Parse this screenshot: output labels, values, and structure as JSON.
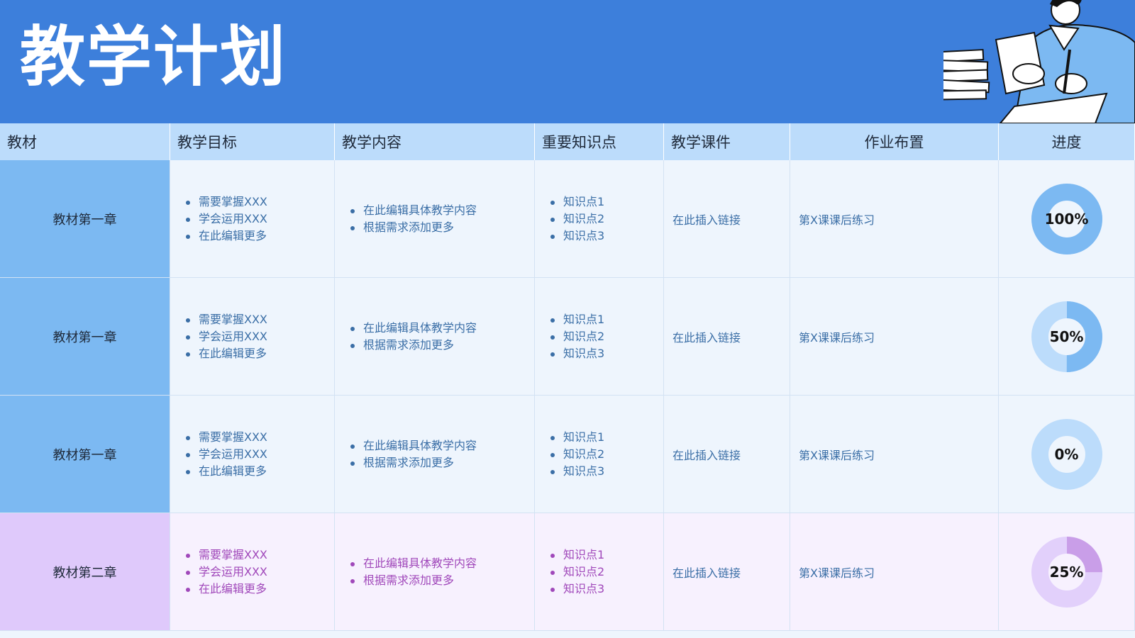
{
  "header": {
    "title": "教学计划"
  },
  "columns": [
    {
      "label": "教材"
    },
    {
      "label": "教学目标"
    },
    {
      "label": "教学内容"
    },
    {
      "label": "重要知识点"
    },
    {
      "label": "教学课件"
    },
    {
      "label": "作业布置"
    },
    {
      "label": "进度"
    }
  ],
  "colors": {
    "header_bg": "#3d7fdb",
    "blue_track": "#bcdcfb",
    "blue_fill": "#7cb9f2",
    "purple_track": "#e2d0fb",
    "purple_fill": "#c99ee8"
  },
  "rows": [
    {
      "theme": "blue",
      "textbook": "教材第一章",
      "goals": [
        "需要掌握XXX",
        "学会运用XXX",
        "在此编辑更多"
      ],
      "content": [
        "在此编辑具体教学内容",
        "根据需求添加更多"
      ],
      "points": [
        "知识点1",
        "知识点2",
        "知识点3"
      ],
      "courseware": "在此插入链接",
      "homework": "第X课课后练习",
      "progress": 100,
      "progress_label": "100%"
    },
    {
      "theme": "blue",
      "textbook": "教材第一章",
      "goals": [
        "需要掌握XXX",
        "学会运用XXX",
        "在此编辑更多"
      ],
      "content": [
        "在此编辑具体教学内容",
        "根据需求添加更多"
      ],
      "points": [
        "知识点1",
        "知识点2",
        "知识点3"
      ],
      "courseware": "在此插入链接",
      "homework": "第X课课后练习",
      "progress": 50,
      "progress_label": "50%"
    },
    {
      "theme": "blue",
      "textbook": "教材第一章",
      "goals": [
        "需要掌握XXX",
        "学会运用XXX",
        "在此编辑更多"
      ],
      "content": [
        "在此编辑具体教学内容",
        "根据需求添加更多"
      ],
      "points": [
        "知识点1",
        "知识点2",
        "知识点3"
      ],
      "courseware": "在此插入链接",
      "homework": "第X课课后练习",
      "progress": 0,
      "progress_label": "0%"
    },
    {
      "theme": "purple",
      "textbook": "教材第二章",
      "goals": [
        "需要掌握XXX",
        "学会运用XXX",
        "在此编辑更多"
      ],
      "content": [
        "在此编辑具体教学内容",
        "根据需求添加更多"
      ],
      "points": [
        "知识点1",
        "知识点2",
        "知识点3"
      ],
      "courseware": "在此插入链接",
      "homework": "第X课课后练习",
      "progress": 25,
      "progress_label": "25%"
    }
  ]
}
